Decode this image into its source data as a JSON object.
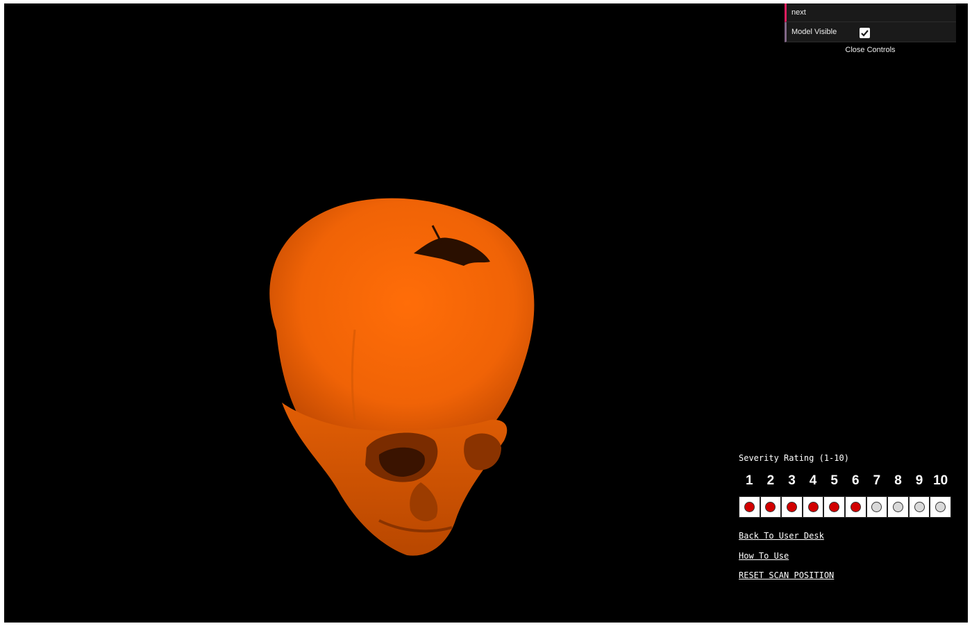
{
  "controls": {
    "button_label": "next",
    "model_visible_label": "Model Visible",
    "model_visible_checked": true,
    "close_label": "Close Controls"
  },
  "severity": {
    "title": "Severity Rating (1-10)",
    "ratings": [
      "1",
      "2",
      "3",
      "4",
      "5",
      "6",
      "7",
      "8",
      "9",
      "10"
    ],
    "selected": 6,
    "active_color": "#d10000",
    "inactive_color": "#d9d9d9"
  },
  "links": {
    "back": "Back To User Desk",
    "how": "How To Use",
    "reset": "RESET SCAN POSITION"
  },
  "model": {
    "color": "#f26a0e"
  }
}
